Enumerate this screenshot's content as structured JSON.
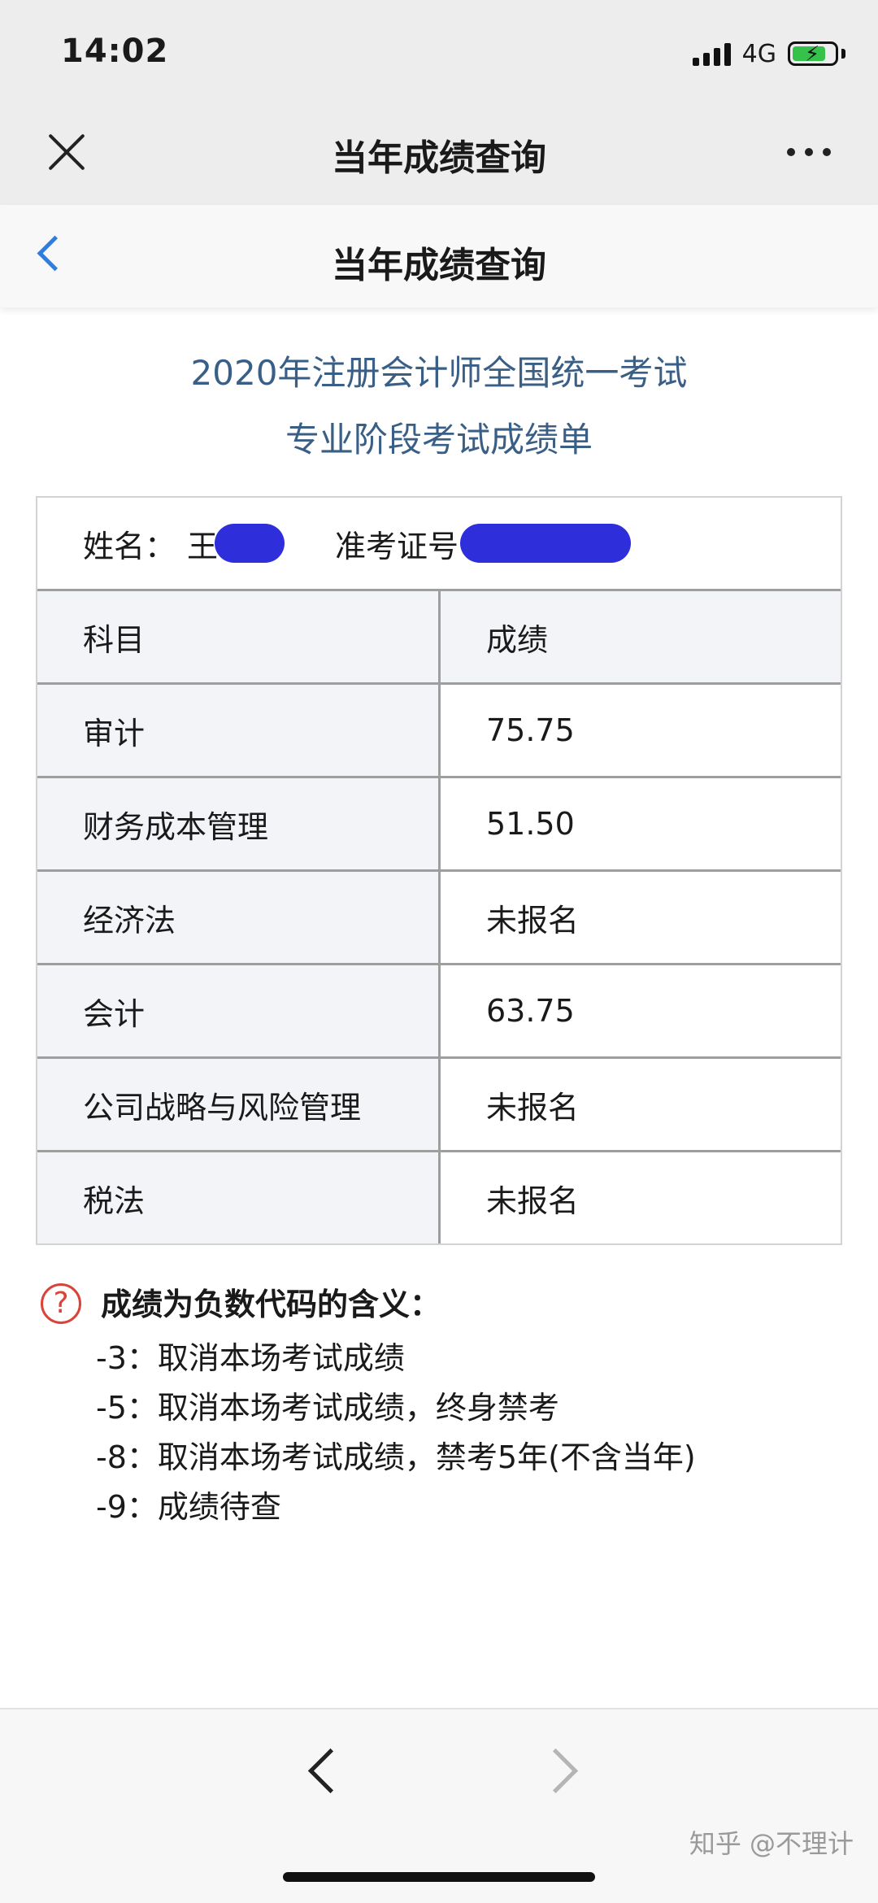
{
  "status_bar": {
    "time": "14:02",
    "network": "4G"
  },
  "wechat_bar": {
    "title": "当年成绩查询"
  },
  "page_header": {
    "title": "当年成绩查询"
  },
  "report": {
    "title_line1": "2020年注册会计师全国统一考试",
    "title_line2": "专业阶段考试成绩单"
  },
  "candidate": {
    "name_label": "姓名：",
    "name_value": "王",
    "exam_id_label": "准考证号"
  },
  "table": {
    "header": {
      "subject": "科目",
      "score": "成绩"
    },
    "rows": [
      {
        "subject": "审计",
        "score": "75.75"
      },
      {
        "subject": "财务成本管理",
        "score": "51.50"
      },
      {
        "subject": "经济法",
        "score": "未报名"
      },
      {
        "subject": "会计",
        "score": "63.75"
      },
      {
        "subject": "公司战略与风险管理",
        "score": "未报名"
      },
      {
        "subject": "税法",
        "score": "未报名"
      }
    ]
  },
  "notes": {
    "icon": "help-circle-icon",
    "title": "成绩为负数代码的含义：",
    "items": [
      "-3：取消本场考试成绩",
      "-5：取消本场考试成绩，终身禁考",
      "-8：取消本场考试成绩，禁考5年(不含当年)",
      "-9：成绩待查"
    ]
  },
  "watermark": "知乎 @不理计",
  "colors": {
    "link_blue": "#2f7de1",
    "title_blue": "#3a5f86",
    "mask_blue": "#2e2edb",
    "help_red": "#d9443a",
    "battery_green": "#35c24a"
  }
}
